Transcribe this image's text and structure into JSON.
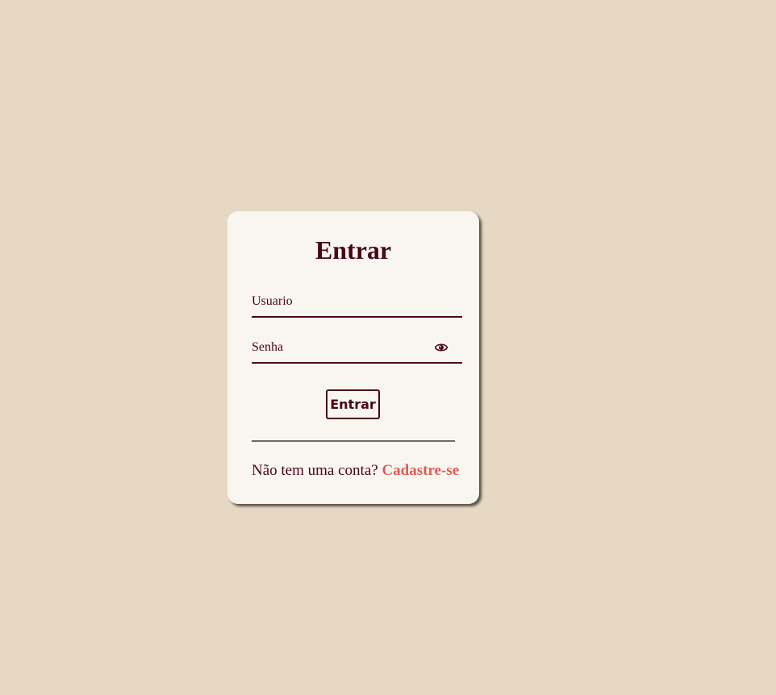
{
  "login": {
    "title": "Entrar",
    "username_placeholder": "Usuario",
    "password_placeholder": "Senha",
    "password_toggle_icon": "eye-icon",
    "submit_label": "Entrar",
    "signup_prompt": "Não tem uma conta?",
    "signup_link": "Cadastre-se"
  },
  "colors": {
    "background": "#e7d8c4",
    "card": "#f9f6f0",
    "primary": "#4a0518",
    "link": "#e05a55"
  }
}
